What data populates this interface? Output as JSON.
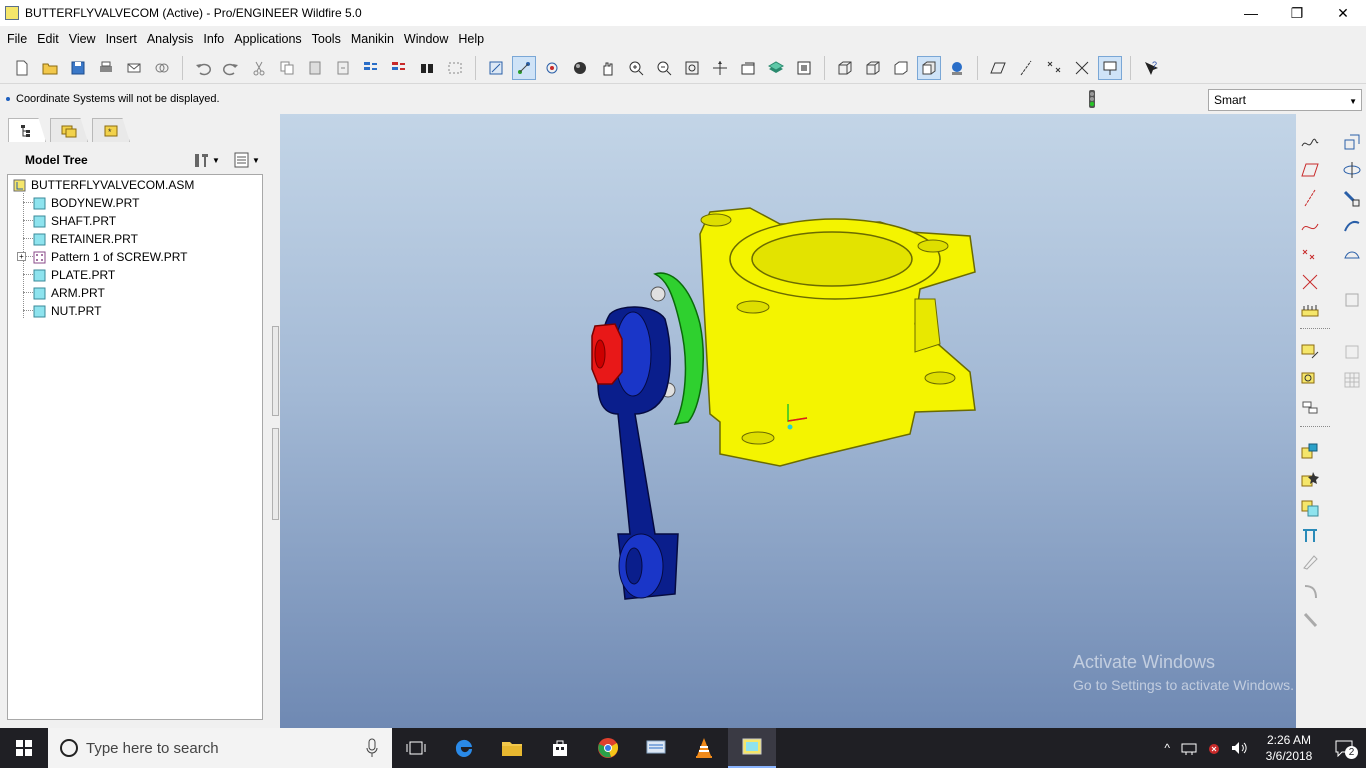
{
  "window": {
    "title": "BUTTERFLYVALVECOM (Active) - Pro/ENGINEER Wildfire 5.0",
    "min_label": "—",
    "restore_label": "❐",
    "close_label": "✕"
  },
  "menu": [
    "File",
    "Edit",
    "View",
    "Insert",
    "Analysis",
    "Info",
    "Applications",
    "Tools",
    "Manikin",
    "Window",
    "Help"
  ],
  "message": "Coordinate Systems will not be displayed.",
  "filter": {
    "selected": "Smart"
  },
  "model_tree": {
    "title": "Model Tree",
    "root": "BUTTERFLYVALVECOM.ASM",
    "items": [
      {
        "label": "BODYNEW.PRT"
      },
      {
        "label": "SHAFT.PRT"
      },
      {
        "label": "RETAINER.PRT"
      },
      {
        "label": "Pattern 1 of SCREW.PRT",
        "expander": "+"
      },
      {
        "label": "PLATE.PRT"
      },
      {
        "label": "ARM.PRT"
      },
      {
        "label": "NUT.PRT"
      }
    ]
  },
  "watermark": {
    "line1": "Activate Windows",
    "line2": "Go to Settings to activate Windows."
  },
  "taskbar": {
    "search_placeholder": "Type here to search",
    "time": "2:26 AM",
    "date": "3/6/2018",
    "notification_count": "2"
  },
  "colors": {
    "accent": "#1d5fbf",
    "body_yellow": "#f4f400",
    "arm_blue": "#0a1e8c",
    "retainer_green": "#2fd02f",
    "nut_red": "#e81818"
  }
}
